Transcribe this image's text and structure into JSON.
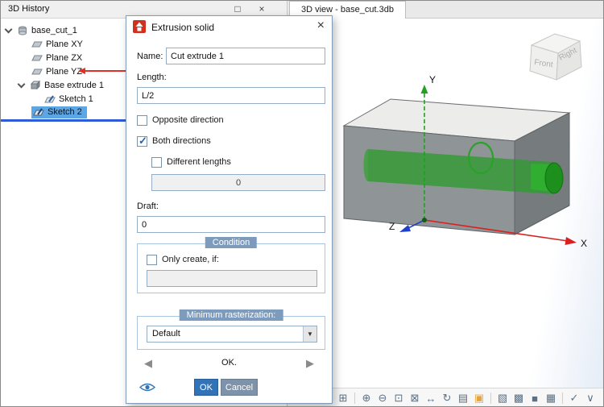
{
  "left_panel": {
    "title": "3D History",
    "tree": {
      "items": [
        {
          "label": "base_cut_1"
        },
        {
          "label": "Plane XY"
        },
        {
          "label": "Plane ZX"
        },
        {
          "label": "Plane YZ"
        },
        {
          "label": "Base extrude 1"
        },
        {
          "label": "Sketch 1"
        },
        {
          "label": "Sketch 2"
        }
      ]
    }
  },
  "window_controls": {
    "maximize_glyph": "□",
    "close_glyph": "×"
  },
  "view_tab": {
    "label": "3D view - base_cut.3db"
  },
  "dialog": {
    "title": "Extrusion solid",
    "close_glyph": "×",
    "name_label": "Name:",
    "name_value": "Cut extrude 1",
    "length_label": "Length:",
    "length_value": "L/2",
    "opposite_direction_label": "Opposite direction",
    "both_directions_label": "Both directions",
    "different_lengths_label": "Different lengths",
    "different_lengths_value": "0",
    "draft_label": "Draft:",
    "draft_value": "0",
    "condition": {
      "title": "Condition",
      "only_create_label": "Only create, if:",
      "value": ""
    },
    "raster": {
      "title": "Minimum rasterization:",
      "value": "Default",
      "arrow_glyph": "▼"
    },
    "nav_prev_glyph": "◀",
    "nav_next_glyph": "▶",
    "nav_text": "OK.",
    "ok_label": "OK",
    "cancel_label": "Cancel"
  },
  "viewport": {
    "axes": {
      "x": "X",
      "y": "Y",
      "z": "Z"
    },
    "view_cube": {
      "front": "Front",
      "right": "Right"
    }
  },
  "toolbar": {
    "icons": [
      {
        "name": "viewport-layout",
        "glyph": "⊞"
      },
      {
        "name": "zoom-in",
        "glyph": "⊕"
      },
      {
        "name": "zoom-out",
        "glyph": "⊖"
      },
      {
        "name": "zoom-window",
        "glyph": "⊡"
      },
      {
        "name": "zoom-all",
        "glyph": "⊠"
      },
      {
        "name": "pan",
        "glyph": "↔"
      },
      {
        "name": "rotate-view",
        "glyph": "↻"
      },
      {
        "name": "sheet",
        "glyph": "▤"
      },
      {
        "name": "active-document",
        "glyph": "▣"
      },
      {
        "name": "workplane",
        "glyph": "▧"
      },
      {
        "name": "cube-wireframe",
        "glyph": "▩"
      },
      {
        "name": "cube-shaded",
        "glyph": "■"
      },
      {
        "name": "measure-grid",
        "glyph": "▦"
      },
      {
        "name": "apply-check",
        "glyph": "✓"
      },
      {
        "name": "toolbar-overflow",
        "glyph": "∨"
      }
    ]
  },
  "colors": {
    "accent_blue": "#3273b8",
    "selection_blue": "#5ca6e6",
    "insertion_bar_blue": "#2f5bd8",
    "annotation_red": "#e23028",
    "model_green": "#2aa22a",
    "group_header_slate": "#7d9cbd",
    "ok_button_blue": "#3273b8",
    "cancel_button_slate": "#7e93a9",
    "dialog_icon_red": "#d2301e"
  }
}
